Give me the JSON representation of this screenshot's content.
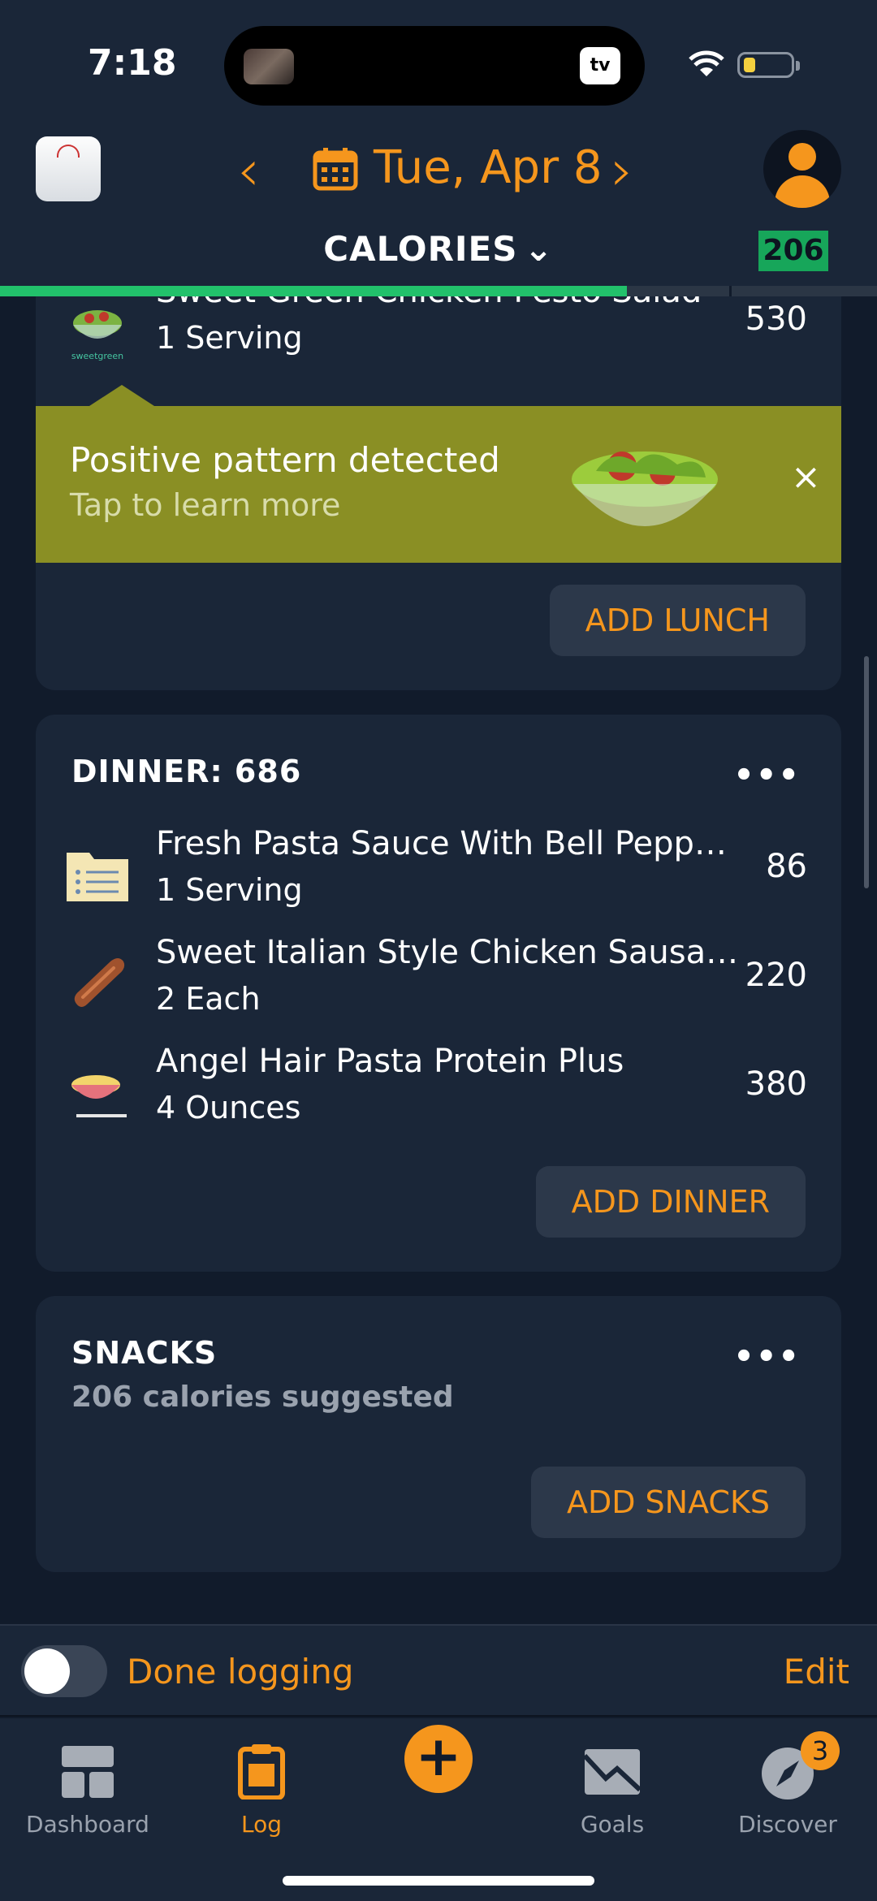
{
  "status_bar": {
    "time": "7:18",
    "tv_label": "tv"
  },
  "header": {
    "date": "Tue, Apr 8",
    "mode": "CALORIES",
    "remaining": "206",
    "progress_fraction": 0.715
  },
  "lunch": {
    "items": [
      {
        "name": "Sweet Green Chicken Pesto Salad",
        "amount": "1 Serving",
        "calories": "530",
        "icon": "salad-bowl-icon",
        "brand": "sweetgreen"
      }
    ],
    "add_label": "ADD LUNCH"
  },
  "banner": {
    "title": "Positive pattern detected",
    "subtitle": "Tap to learn more",
    "close": "×"
  },
  "dinner": {
    "heading": "DINNER: 686",
    "more": "•••",
    "items": [
      {
        "name": "Fresh Pasta Sauce With Bell Peppers",
        "amount": "1 Serving",
        "calories": "86",
        "icon": "recipe-folder-icon"
      },
      {
        "name": "Sweet Italian Style Chicken Sausa…",
        "amount": "2 Each",
        "calories": "220",
        "icon": "sausage-icon"
      },
      {
        "name": "Angel Hair Pasta Protein Plus",
        "amount": "4 Ounces",
        "calories": "380",
        "icon": "pasta-bowl-icon"
      }
    ],
    "add_label": "ADD DINNER"
  },
  "snacks": {
    "heading": "SNACKS",
    "suggestion": "206 calories suggested",
    "more": "•••",
    "add_label": "ADD SNACKS"
  },
  "done_bar": {
    "label": "Done logging",
    "edit": "Edit",
    "toggle_on": false
  },
  "tabs": [
    {
      "label": "Dashboard",
      "icon": "dashboard-icon"
    },
    {
      "label": "Log",
      "icon": "clipboard-icon",
      "active": true
    },
    {
      "label": "",
      "icon": "plus-icon"
    },
    {
      "label": "Goals",
      "icon": "goals-icon"
    },
    {
      "label": "Discover",
      "icon": "compass-icon",
      "badge": "3"
    }
  ],
  "colors": {
    "accent": "#f5961d",
    "background": "#111b2b",
    "card": "#1a2638",
    "success": "#22c16b",
    "banner": "#8a8f24"
  }
}
